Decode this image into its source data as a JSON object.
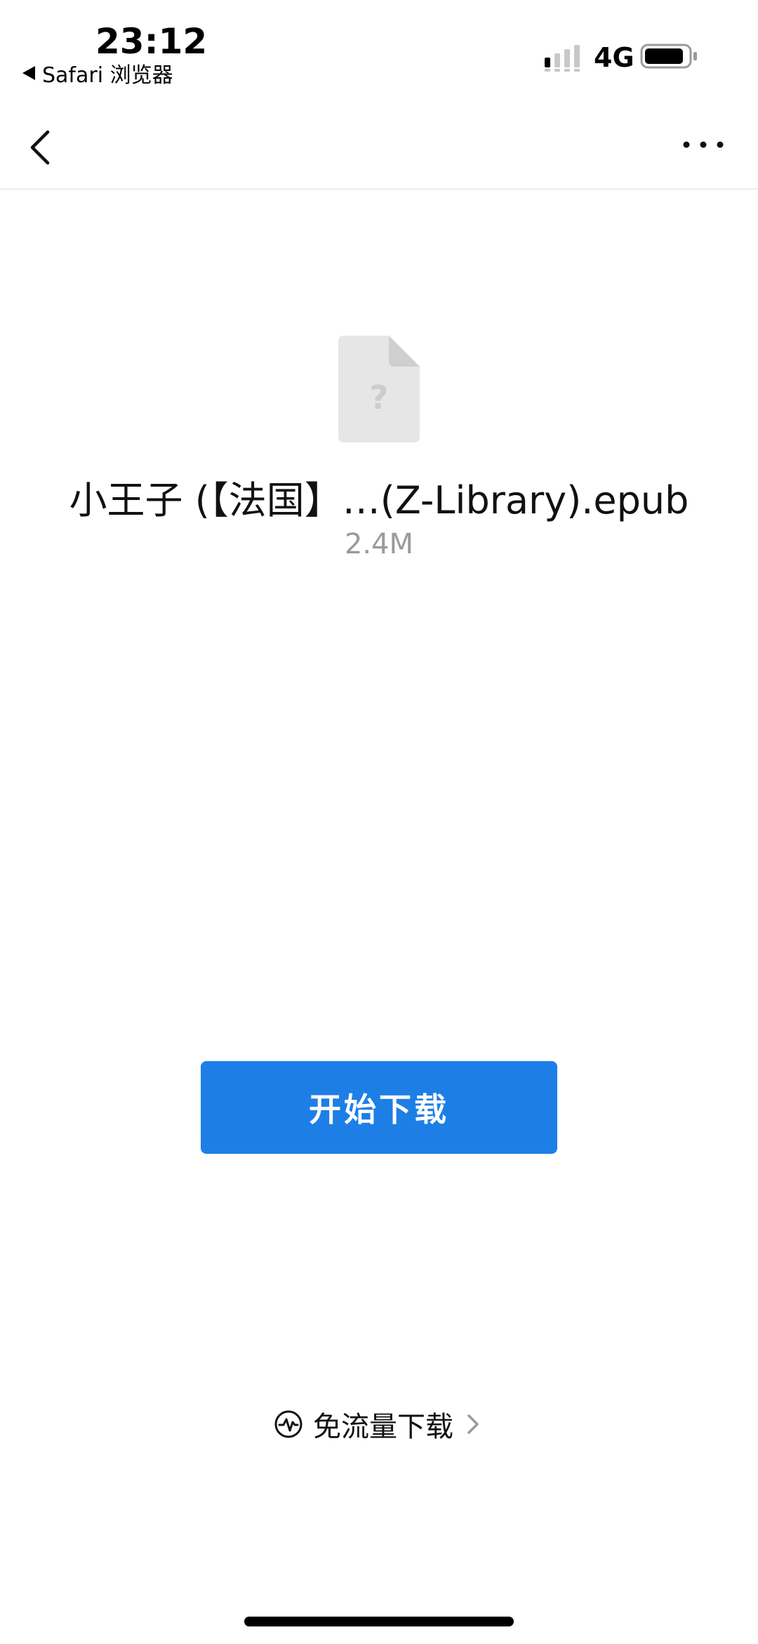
{
  "status_bar": {
    "time": "23:12",
    "back_app": "Safari 浏览器",
    "network": "4G",
    "signal_icon": "signal-bars-icon",
    "battery_icon": "battery-icon"
  },
  "nav": {
    "back_icon": "chevron-left-icon",
    "more_icon": "more-dots-icon"
  },
  "file": {
    "icon": "unknown-file-icon",
    "name": "小王子 (【法国】…(Z-Library).epub",
    "size": "2.4M"
  },
  "download": {
    "label": "开始下载",
    "color": "#1d7fe6"
  },
  "free_data": {
    "icon": "activity-pulse-icon",
    "label": "免流量下载",
    "arrow_icon": "chevron-right-icon"
  }
}
